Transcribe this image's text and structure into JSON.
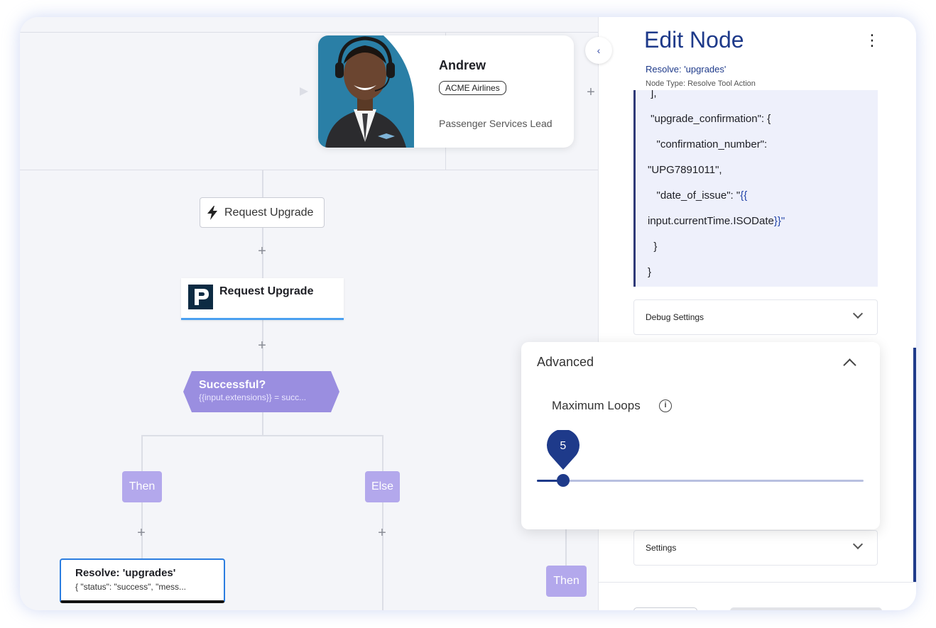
{
  "agent_card": {
    "name": "Andrew",
    "company_tag": "ACME Airlines",
    "role": "Passenger Services Lead"
  },
  "flow": {
    "trigger_label": "Request Upgrade",
    "action_label": "Request Upgrade",
    "condition": {
      "title": "Successful?",
      "expression": "{{input.extensions}} = succ..."
    },
    "then_label": "Then",
    "else_label": "Else",
    "then_label_right": "Then",
    "resolve_node": {
      "title": "Resolve: 'upgrades'",
      "subtitle": "{ \"status\": \"success\", \"mess..."
    }
  },
  "panel": {
    "title": "Edit Node",
    "node_name": "Resolve: 'upgrades'",
    "node_type": "Node Type: Resolve Tool Action",
    "code_lines": [
      {
        "text": " ],",
        "highlight": ""
      },
      {
        "text": " \"upgrade_confirmation\": {",
        "highlight": ""
      },
      {
        "text": "   \"confirmation_number\":",
        "highlight": ""
      },
      {
        "text": "\"UPG7891011\",",
        "highlight": ""
      },
      {
        "text": "   \"date_of_issue\": \"",
        "highlight": "{{"
      },
      {
        "text": "input.currentTime.ISODate",
        "highlight": "}}\""
      },
      {
        "text": "  }",
        "highlight": ""
      },
      {
        "text": "}",
        "highlight": ""
      }
    ],
    "debug_settings_label": "Debug Settings",
    "settings_label": "Settings"
  },
  "advanced": {
    "title": "Advanced",
    "max_loops_label": "Maximum Loops",
    "max_loops_value": "5",
    "slider_fraction": 0.08
  },
  "colors": {
    "accent": "#1e3a8a",
    "condition": "#9a8ee0",
    "branch": "#b3a8ec"
  }
}
